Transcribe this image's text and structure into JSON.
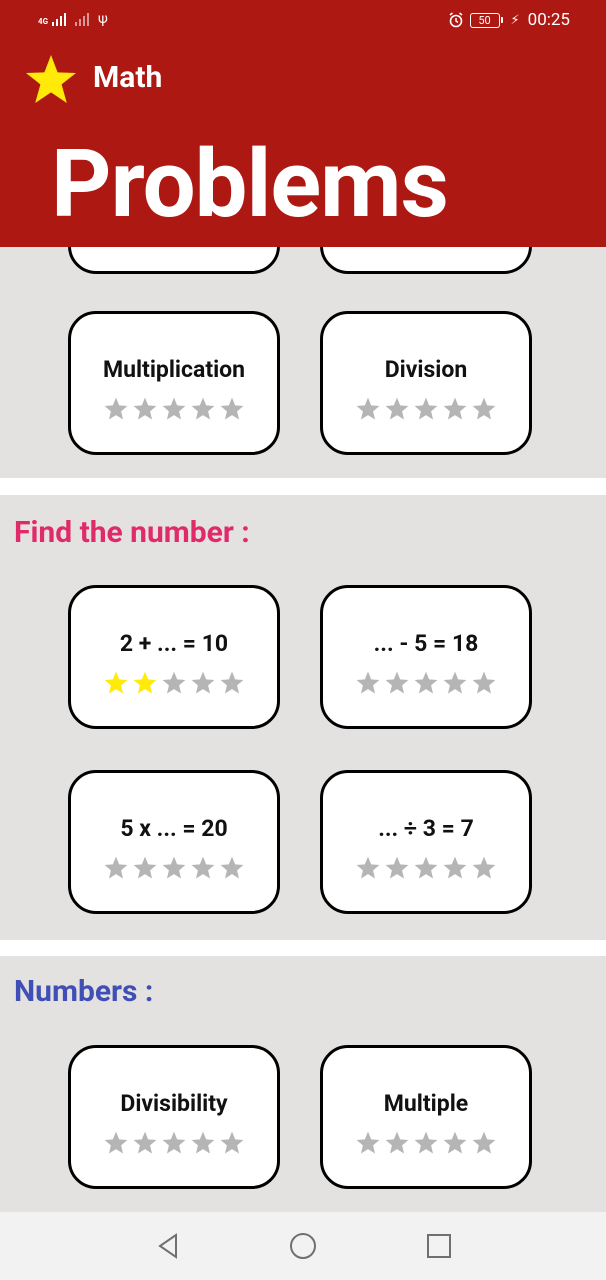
{
  "status_bar": {
    "network_label": "4G",
    "time": "00:25",
    "battery_level": "50",
    "icons": [
      "signal-icon",
      "no-signal-icon",
      "usb-icon",
      "alarm-icon",
      "battery-icon",
      "charging-icon"
    ]
  },
  "header": {
    "app_name": "Math",
    "title": "Problems",
    "background_color": "#ad1812",
    "icon": "star-icon"
  },
  "colors": {
    "section_bg": "#e4e1e1",
    "star_filled": "#ffea0a",
    "star_empty": "#b5b5b5",
    "find_title": "#e02b6a",
    "numbers_title": "#3f4fb5"
  },
  "sections": [
    {
      "title": "",
      "cards": [
        {
          "label": "",
          "stars": 0
        },
        {
          "label": "",
          "stars": 0
        },
        {
          "label": "Multiplication",
          "stars": 0
        },
        {
          "label": "Division",
          "stars": 0
        }
      ]
    },
    {
      "title": "Find the number :",
      "cards": [
        {
          "label": "2 + ... = 10",
          "stars": 2
        },
        {
          "label": "... - 5 = 18",
          "stars": 0
        },
        {
          "label": "5 x ... = 20",
          "stars": 0
        },
        {
          "label": "... ÷ 3 = 7",
          "stars": 0
        }
      ]
    },
    {
      "title": "Numbers :",
      "cards": [
        {
          "label": "Divisibility",
          "stars": 0
        },
        {
          "label": "Multiple",
          "stars": 0
        }
      ]
    }
  ],
  "nav": {
    "buttons": [
      "back-icon",
      "home-icon",
      "recents-icon"
    ]
  }
}
